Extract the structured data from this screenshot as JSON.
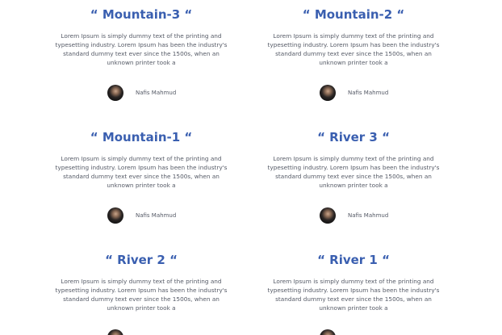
{
  "cards": [
    {
      "title": "“ Mountain-3 “",
      "text": "Lorem Ipsum is simply dummy text of the printing and typesetting industry. Lorem Ipsum has been the industry's standard dummy text ever since the 1500s, when an unknown printer took a",
      "author": "Nafis Mahmud"
    },
    {
      "title": "“ Mountain-2 “",
      "text": "Lorem Ipsum is simply dummy text of the printing and typesetting industry. Lorem Ipsum has been the industry's standard dummy text ever since the 1500s, when an unknown printer took a",
      "author": "Nafis Mahmud"
    },
    {
      "title": "“ Mountain-1 “",
      "text": "Lorem Ipsum is simply dummy text of the printing and typesetting industry. Lorem Ipsum has been the industry's standard dummy text ever since the 1500s, when an unknown printer took a",
      "author": "Nafis Mahmud"
    },
    {
      "title": "“ River 3 “",
      "text": "Lorem Ipsum is simply dummy text of the printing and typesetting industry. Lorem Ipsum has been the industry's standard dummy text ever since the 1500s, when an unknown printer took a",
      "author": "Nafis Mahmud"
    },
    {
      "title": "“ River 2 “",
      "text": "Lorem Ipsum is simply dummy text of the printing and typesetting industry. Lorem Ipsum has been the industry's standard dummy text ever since the 1500s, when an unknown printer took a",
      "author": ""
    },
    {
      "title": "“ River 1 “",
      "text": "Lorem Ipsum is simply dummy text of the printing and typesetting industry. Lorem Ipsum has been the industry's standard dummy text ever since the 1500s, when an unknown printer took a",
      "author": ""
    }
  ],
  "colors": {
    "title": "#3a5fb0",
    "text": "#555a66",
    "background": "#ffffff"
  },
  "icons": {
    "avatar": "author-avatar"
  }
}
